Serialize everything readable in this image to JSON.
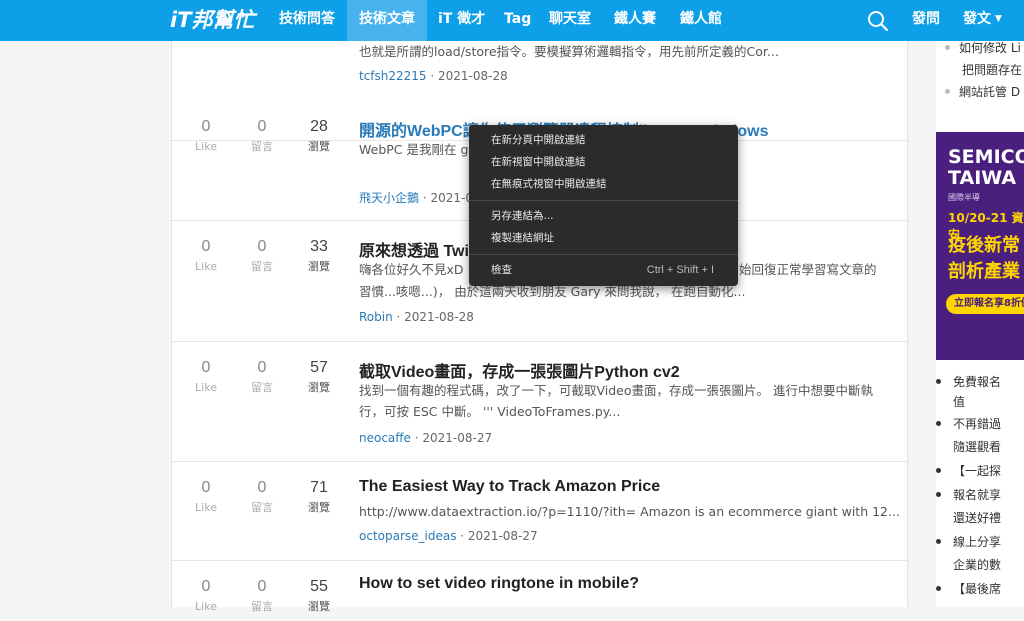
{
  "header": {
    "logo": "iT邦幫忙",
    "nav": [
      {
        "label": "技術問答"
      },
      {
        "label": "技術文章"
      },
      {
        "label": "iT 徵才"
      },
      {
        "label": "Tag"
      },
      {
        "label": "聊天室"
      },
      {
        "label": "鐵人賽"
      },
      {
        "label": "鐵人館"
      }
    ],
    "ask_label": "發問",
    "post_label": "發文"
  },
  "articles": [
    {
      "excerpt": "也就是所謂的load/store指令。要模擬算術邏輯指令，用先前所定義的Cor...",
      "author": "tcfsh22215",
      "date": "2021-08-28"
    },
    {
      "likes": "0",
      "like_label": "Like",
      "comments": "0",
      "comment_label": "留言",
      "views": "28",
      "view_label": "瀏覽",
      "title": "開源的WebPC讓你使用瀏覽器遠程控制linux or windows",
      "excerpt": "WebPC 是我剛在 g                                            TeamViewer 等的替代品，你可以通過瀏",
      "author": "飛天小企鵝",
      "date": "2021-0"
    },
    {
      "likes": "0",
      "like_label": "Like",
      "comments": "0",
      "comment_label": "留言",
      "views": "33",
      "view_label": "瀏覽",
      "title": "原來想透過 Twi",
      "excerpt_l1": "嗨各位好久不見xD",
      "excerpt_l1b": "始回復正常學習寫文章的",
      "excerpt_l2": "習慣...咳嗯...)， 由於這兩天收到朋友 Gary 來問我說， 在跑自動化...",
      "author": "Robin",
      "date": "2021-08-28"
    },
    {
      "likes": "0",
      "like_label": "Like",
      "comments": "0",
      "comment_label": "留言",
      "views": "57",
      "view_label": "瀏覽",
      "title": "截取Video畫面，存成一張張圖片Python cv2",
      "excerpt": "找到一個有趣的程式碼，改了一下，可截取Video畫面，存成一張張圖片。 進行中想要中斷執行，可按 ESC 中斷。 ''' VideoToFrames.py...",
      "author": "neocaffe",
      "date": "2021-08-27"
    },
    {
      "likes": "0",
      "like_label": "Like",
      "comments": "0",
      "comment_label": "留言",
      "views": "71",
      "view_label": "瀏覽",
      "title": "The Easiest Way to Track Amazon Price",
      "excerpt": "http://www.dataextraction.io/?p=1110/?ith= Amazon is an ecommerce giant with 12...",
      "author": "octoparse_ideas",
      "date": "2021-08-27"
    },
    {
      "likes": "0",
      "like_label": "Like",
      "comments": "0",
      "comment_label": "留言",
      "views": "55",
      "view_label": "瀏覽",
      "title": "How to set video ringtone in mobile?"
    }
  ],
  "context_menu": {
    "items": [
      {
        "label": "在新分頁中開啟連結"
      },
      {
        "label": "在新視窗中開啟連結"
      },
      {
        "label": "在無痕式視窗中開啟連結"
      },
      {
        "label": "另存連結為..."
      },
      {
        "label": "複製連結網址"
      },
      {
        "label": "檢查",
        "shortcut": "Ctrl + Shift + I"
      }
    ]
  },
  "sidebar": {
    "top_items": [
      "如何修改 Li",
      "把問題存在",
      "網站託管 D"
    ],
    "ad": {
      "line1": "SEMICO",
      "line2": "TAIWA",
      "line3": "國際半導",
      "line4": "10/20-21 資安",
      "line5": "疫後新常",
      "line6": "剖析產業",
      "button": "立即報名享8折優"
    },
    "bottom_items": [
      "免費報名",
      "值",
      "不再錯過",
      "隨選觀看",
      "【一起探",
      "報名就享",
      "還送好禮",
      "線上分享",
      "企業的數",
      "【最後席"
    ]
  }
}
